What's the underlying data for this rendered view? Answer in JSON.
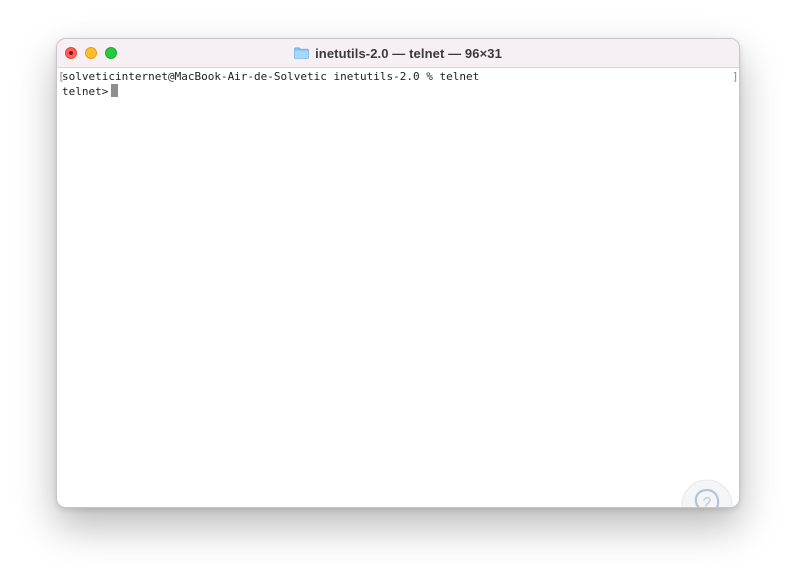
{
  "window": {
    "title": "inetutils-2.0 — telnet — 96×31",
    "folder_icon": "folder-icon"
  },
  "terminal": {
    "line1": "solveticinternet@MacBook-Air-de-Solvetic inetutils-2.0 % telnet",
    "line2": "telnet>",
    "bracket_left": "[",
    "bracket_right": "]"
  },
  "colors": {
    "close": "#fe5f57",
    "minimize": "#febc2e",
    "zoom": "#28c840",
    "titlebar": "#f6eff4",
    "folder": "#7fc2f4"
  }
}
